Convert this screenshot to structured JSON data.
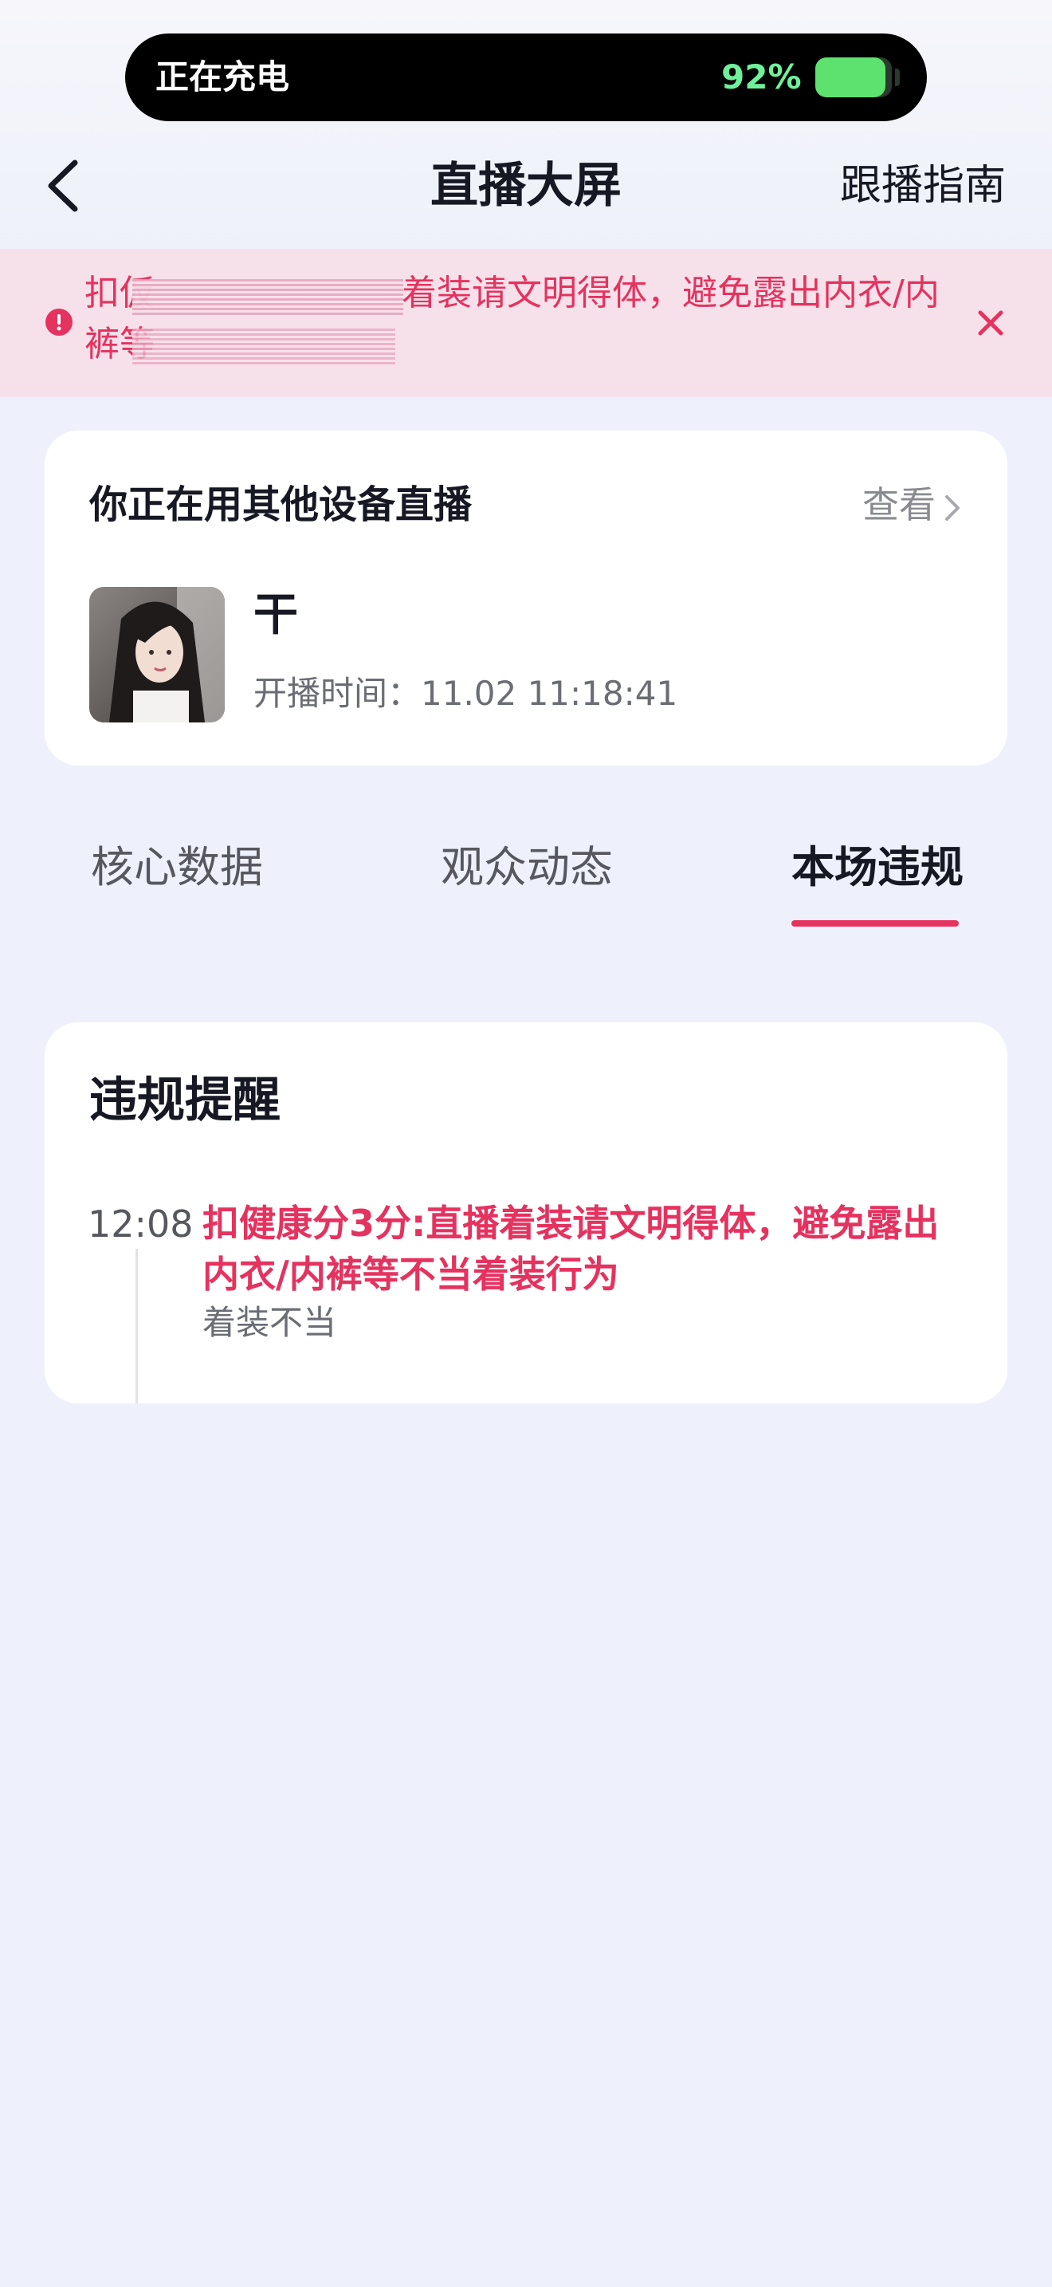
{
  "status_bar": {
    "charging_text": "正在充电",
    "battery_percent_text": "92%",
    "battery_level": 0.92,
    "battery_color": "#5ee26f"
  },
  "nav": {
    "back_icon": "chevron-left-icon",
    "title": "直播大屏",
    "right_link": "跟播指南"
  },
  "banner": {
    "icon": "exclamation-circle-icon",
    "text_line1_prefix": "扣仮",
    "text_line1_suffix": "着装请文明得体，避免露出内衣/内",
    "text_line2_prefix": "裤等",
    "close_icon": "close-icon",
    "accent_color": "#e5325f"
  },
  "device_card": {
    "title": "你正在用其他设备直播",
    "view_label": "查看",
    "user_name": "干",
    "start_time_label": "开播时间：11.02 11:18:41"
  },
  "tabs": [
    {
      "label": "核心数据",
      "active": false
    },
    {
      "label": "观众动态",
      "active": false
    },
    {
      "label": "本场违规",
      "active": true
    }
  ],
  "violation_card": {
    "title": "违规提醒",
    "items": [
      {
        "time": "12:08",
        "text": "扣健康分3分:直播着装请文明得体，避免露出内衣/内裤等不当着装行为",
        "category": "着装不当"
      }
    ]
  }
}
